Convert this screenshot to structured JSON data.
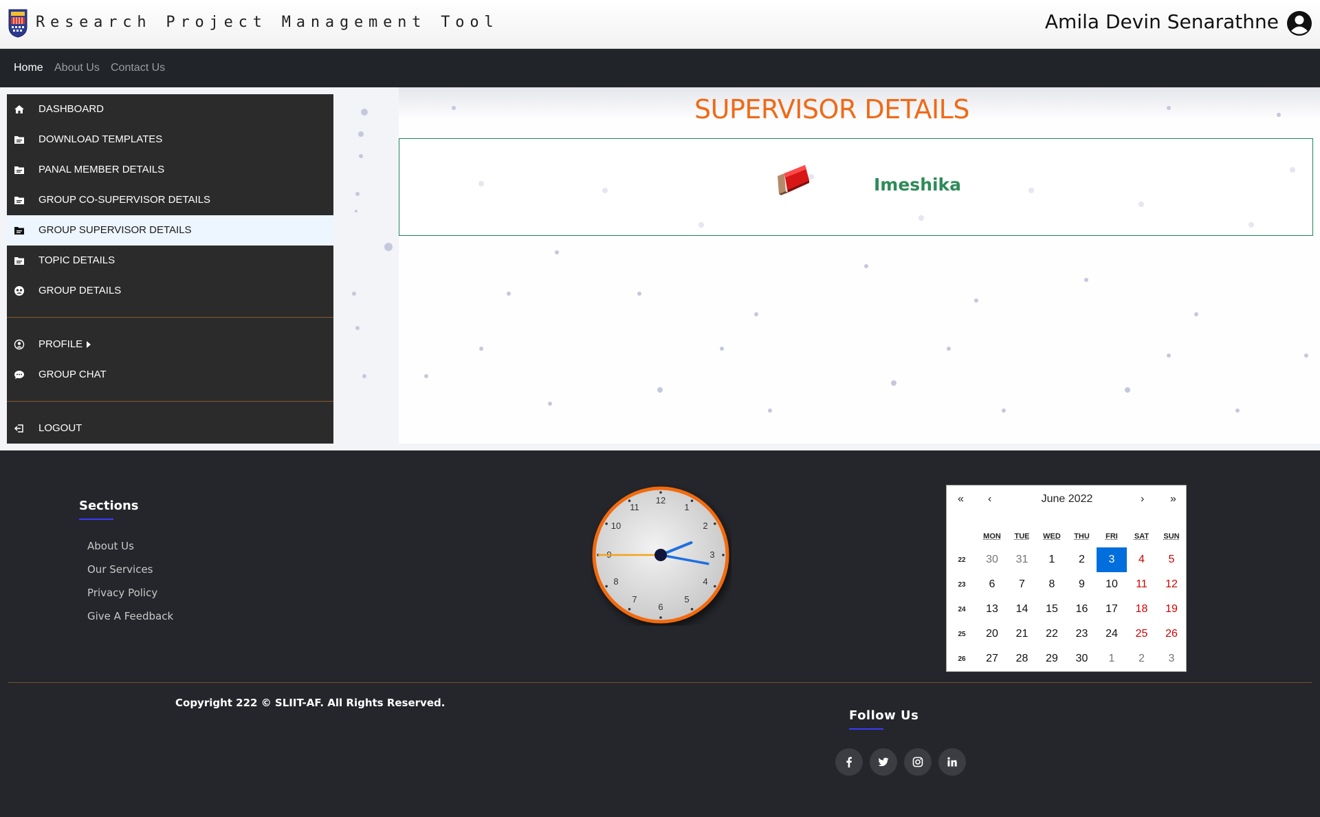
{
  "header": {
    "app_title": "Research Project Management Tool",
    "user_name": "Amila Devin Senarathne",
    "logo_icon": "university-crest-logo",
    "user_icon": "user-circle-icon"
  },
  "nav": {
    "home": "Home",
    "about": "About Us",
    "contact": "Contact Us"
  },
  "sidebar": {
    "items": [
      {
        "label": "DASHBOARD",
        "icon": "home-icon"
      },
      {
        "label": "DOWNLOAD TEMPLATES",
        "icon": "folder-icon"
      },
      {
        "label": "PANAL MEMBER DETAILS",
        "icon": "folder-icon"
      },
      {
        "label": "GROUP CO-SUPERVISOR DETAILS",
        "icon": "folder-icon"
      },
      {
        "label": "GROUP SUPERVISOR DETAILS",
        "icon": "folder-icon",
        "active": true
      },
      {
        "label": "TOPIC DETAILS",
        "icon": "folder-icon"
      },
      {
        "label": "GROUP DETAILS",
        "icon": "group-icon"
      },
      {
        "label": "PROFILE",
        "icon": "user-circle-icon"
      },
      {
        "label": "GROUP CHAT",
        "icon": "chat-icon"
      },
      {
        "label": "LOGOUT",
        "icon": "logout-icon"
      }
    ]
  },
  "content": {
    "title": "SUPERVISOR DETAILS",
    "supervisor_name": "Imeshika",
    "card_image": "rubber-stamp-image"
  },
  "footer": {
    "sections_title": "Sections",
    "links": [
      "About Us",
      "Our Services",
      "Privacy Policy",
      "Give A Feedback"
    ],
    "copyright": "Copyright 222 © SLIIT-AF. All Rights Reserved.",
    "follow_title": "Follow Us",
    "social": [
      "facebook-icon",
      "twitter-icon",
      "instagram-icon",
      "linkedin-icon"
    ],
    "underline_color": "#3a3aff"
  },
  "clock": {
    "numbers": [
      "12",
      "1",
      "2",
      "3",
      "4",
      "5",
      "6",
      "7",
      "8",
      "9",
      "10",
      "11"
    ],
    "time": "14:16:45",
    "rim_color": "#f26b0f"
  },
  "calendar": {
    "month_label": "June 2022",
    "nav": {
      "prev2": "«",
      "prev": "‹",
      "next": "›",
      "next2": "»"
    },
    "weekdays": [
      "MON",
      "TUE",
      "WED",
      "THU",
      "FRI",
      "SAT",
      "SUN"
    ],
    "weeks": [
      {
        "week": "22",
        "days": [
          "30",
          "31",
          "1",
          "2",
          "3",
          "4",
          "5"
        ]
      },
      {
        "week": "23",
        "days": [
          "6",
          "7",
          "8",
          "9",
          "10",
          "11",
          "12"
        ]
      },
      {
        "week": "24",
        "days": [
          "13",
          "14",
          "15",
          "16",
          "17",
          "18",
          "19"
        ]
      },
      {
        "week": "25",
        "days": [
          "20",
          "21",
          "22",
          "23",
          "24",
          "25",
          "26"
        ]
      },
      {
        "week": "26",
        "days": [
          "27",
          "28",
          "29",
          "30",
          "1",
          "2",
          "3"
        ]
      }
    ],
    "selected_day": "3"
  },
  "colors": {
    "accent_orange": "#ef6a16",
    "nav_bg": "#212529",
    "sidebar_bg": "#2b2b2b",
    "footer_bg": "#24262b",
    "card_green": "#2e8b57",
    "calendar_today": "#006edc",
    "calendar_weekend": "#d10000"
  }
}
